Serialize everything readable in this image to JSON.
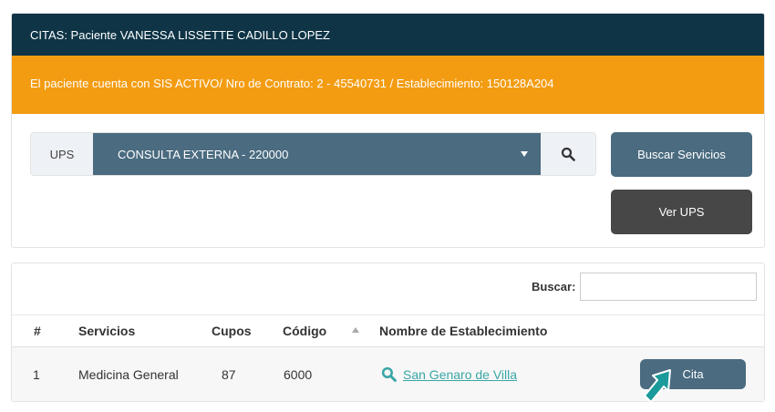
{
  "header": {
    "title": "CITAS: Paciente VANESSA LISSETTE CADILLO LOPEZ"
  },
  "alert": {
    "text": "El paciente cuenta con SIS ACTIVO/ Nro de Contrato: 2 - 45540731 / Establecimiento: 150128A204"
  },
  "ups": {
    "label": "UPS",
    "selected": "CONSULTA EXTERNA - 220000",
    "search_icon": "search-icon"
  },
  "buttons": {
    "buscar_servicios": "Buscar Servicios",
    "ver_ups": "Ver UPS"
  },
  "filter": {
    "label": "Buscar:",
    "value": ""
  },
  "table": {
    "headers": [
      "#",
      "Servicios",
      "Cupos",
      "Código",
      "Nombre de Establecimiento"
    ],
    "rows": [
      {
        "num": "1",
        "servicio": "Medicina General",
        "cupos": "87",
        "codigo": "6000",
        "establecimiento": "San Genaro de Villa",
        "action": "Cita"
      }
    ]
  },
  "colors": {
    "header_bg": "#0e3446",
    "alert_bg": "#f39c12",
    "primary_btn": "#4a6b80",
    "dark_btn": "#474747",
    "link": "#3aa6a6",
    "cursor": "#1a9a9a"
  }
}
